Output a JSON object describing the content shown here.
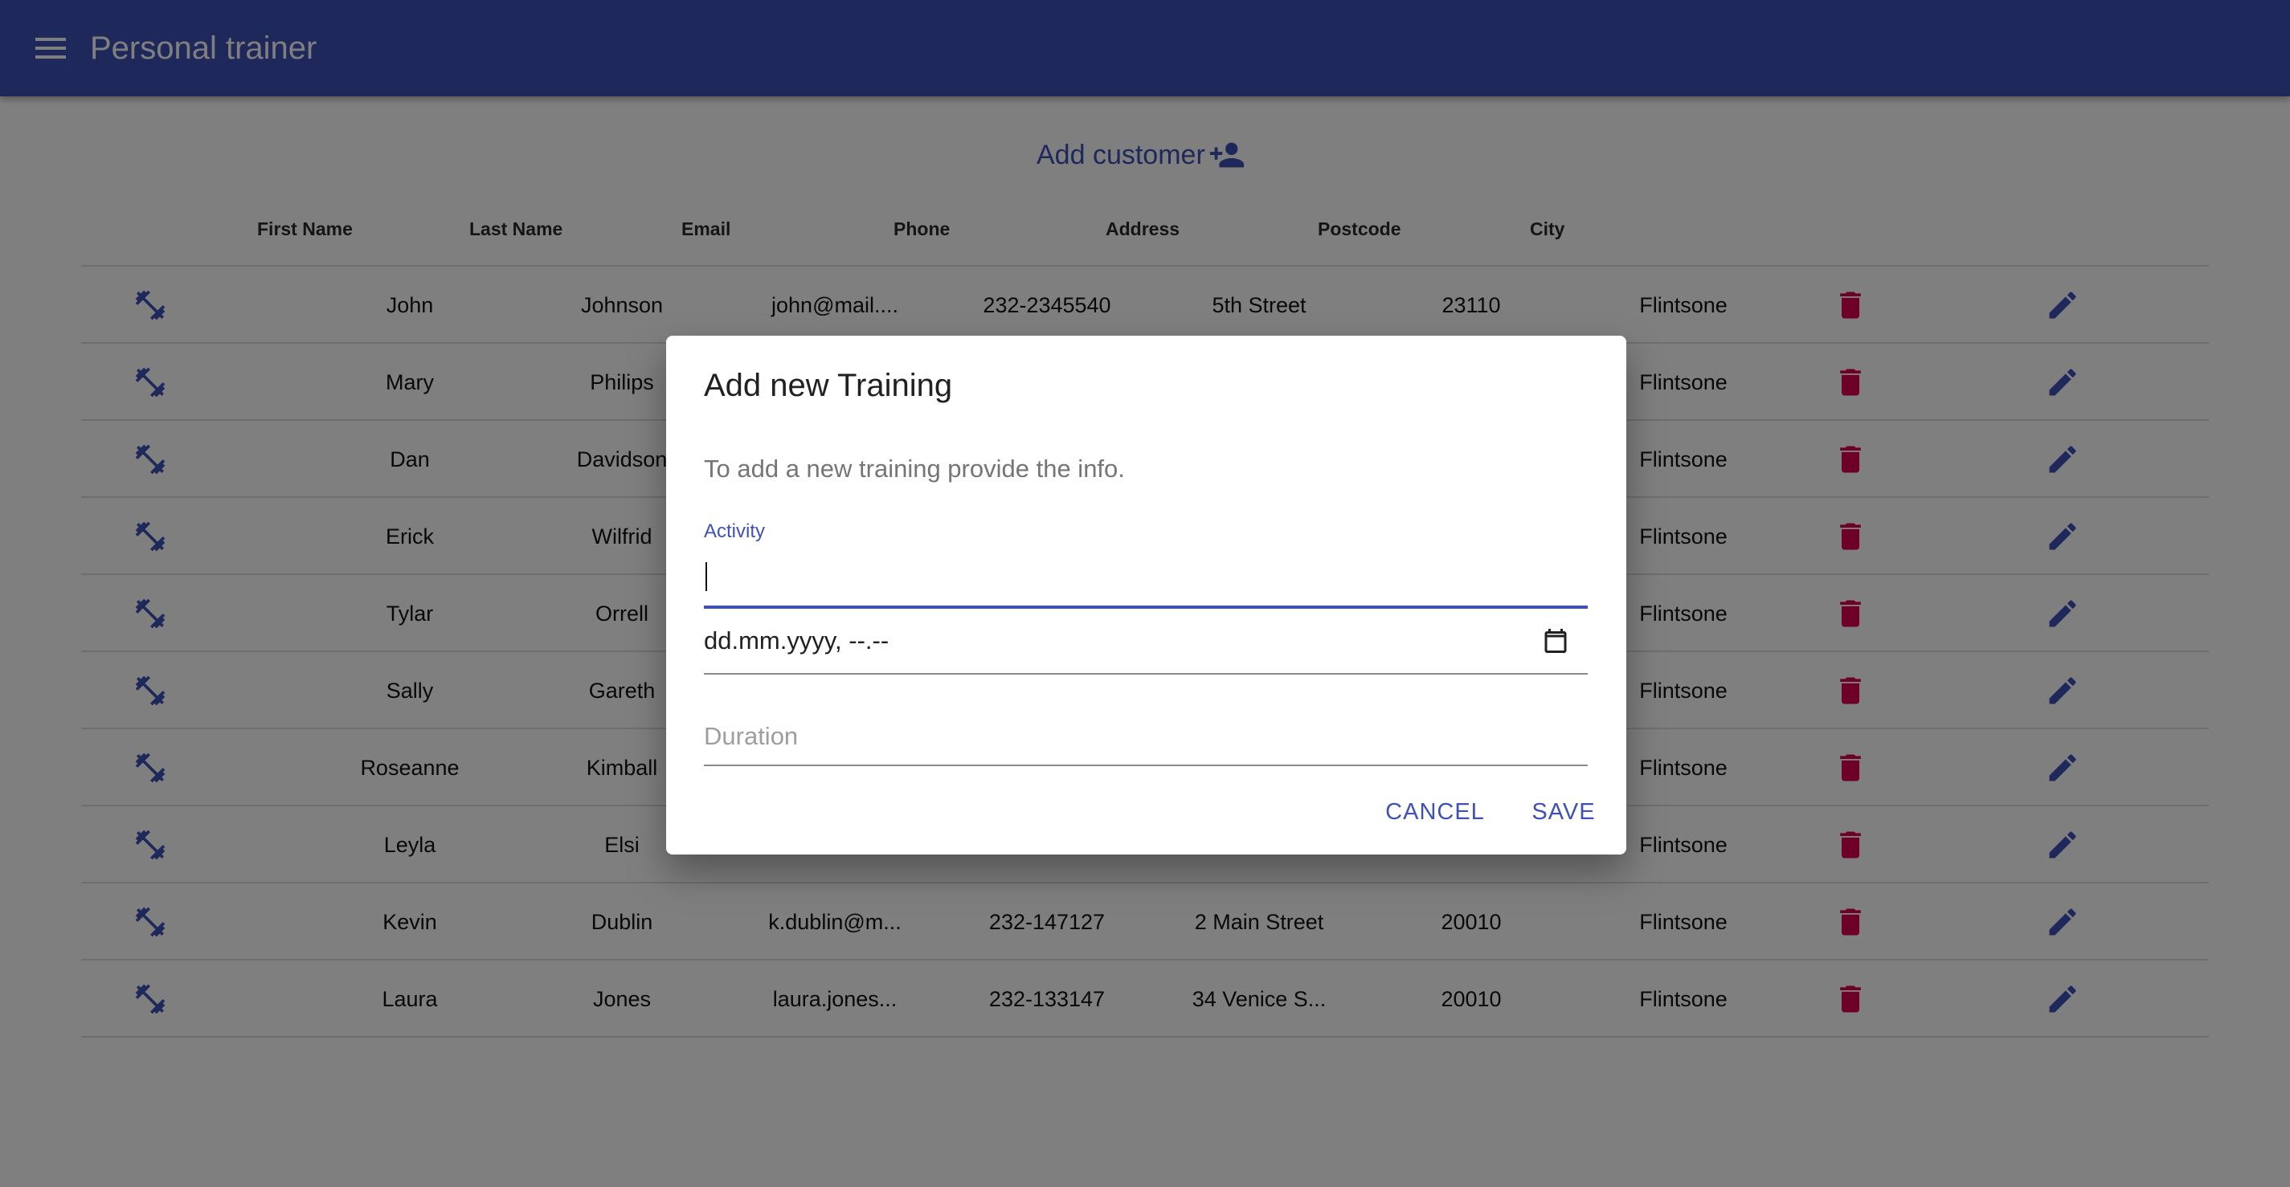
{
  "app": {
    "title": "Personal trainer"
  },
  "add_customer": {
    "label": "Add customer"
  },
  "table": {
    "columns": [
      "First Name",
      "Last Name",
      "Email",
      "Phone",
      "Address",
      "Postcode",
      "City"
    ],
    "rows": [
      {
        "first": "John",
        "last": "Johnson",
        "email": "john@mail....",
        "phone": "232-2345540",
        "address": "5th Street",
        "postcode": "23110",
        "city": "Flintsone"
      },
      {
        "first": "Mary",
        "last": "Philips",
        "email": "",
        "phone": "",
        "address": "",
        "postcode": "",
        "city": "Flintsone"
      },
      {
        "first": "Dan",
        "last": "Davidson",
        "email": "",
        "phone": "",
        "address": "",
        "postcode": "",
        "city": "Flintsone"
      },
      {
        "first": "Erick",
        "last": "Wilfrid",
        "email": "",
        "phone": "",
        "address": "",
        "postcode": "",
        "city": "Flintsone"
      },
      {
        "first": "Tylar",
        "last": "Orrell",
        "email": "",
        "phone": "",
        "address": "",
        "postcode": "",
        "city": "Flintsone"
      },
      {
        "first": "Sally",
        "last": "Gareth",
        "email": "",
        "phone": "",
        "address": "",
        "postcode": "",
        "city": "Flintsone"
      },
      {
        "first": "Roseanne",
        "last": "Kimball",
        "email": "",
        "phone": "",
        "address": "",
        "postcode": "",
        "city": "Flintsone"
      },
      {
        "first": "Leyla",
        "last": "Elsi",
        "email": "",
        "phone": "",
        "address": "",
        "postcode": "",
        "city": "Flintsone"
      },
      {
        "first": "Kevin",
        "last": "Dublin",
        "email": "k.dublin@m...",
        "phone": "232-147127",
        "address": "2 Main Street",
        "postcode": "20010",
        "city": "Flintsone"
      },
      {
        "first": "Laura",
        "last": "Jones",
        "email": "laura.jones...",
        "phone": "232-133147",
        "address": "34 Venice S...",
        "postcode": "20010",
        "city": "Flintsone"
      }
    ]
  },
  "icons": {
    "row_training": "fitness-icon",
    "row_delete": "delete-icon",
    "row_edit": "edit-icon",
    "add_customer": "person-add-icon",
    "menu": "menu-icon",
    "calendar": "calendar-icon"
  },
  "colors": {
    "primary": "#3f51b5",
    "danger": "#dc004e"
  },
  "dialog": {
    "title": "Add new Training",
    "description": "To add a new training provide the info.",
    "activity_label": "Activity",
    "activity_value": "",
    "date_value": "dd.mm.yyyy, --.--",
    "duration_placeholder": "Duration",
    "cancel_label": "CANCEL",
    "save_label": "SAVE"
  }
}
